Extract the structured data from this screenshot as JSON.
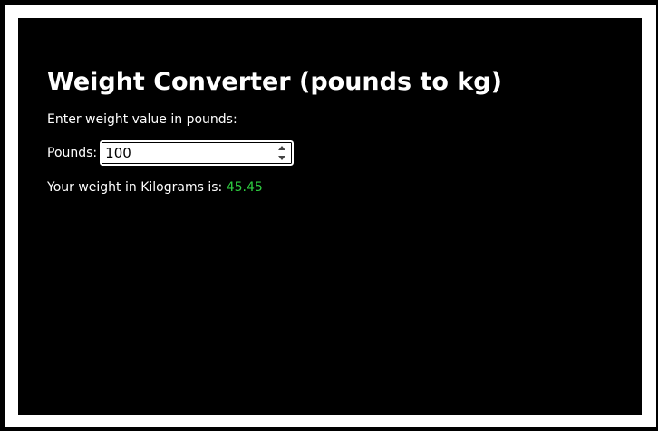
{
  "page": {
    "title": "Weight Converter (pounds to kg)",
    "instruction": "Enter weight value in pounds:"
  },
  "form": {
    "pounds_label": "Pounds:",
    "pounds_value": "100"
  },
  "result": {
    "label": "Your weight in Kilograms is:",
    "value": "45.45"
  },
  "colors": {
    "background": "#000000",
    "border": "#ffffff",
    "text": "#ffffff",
    "result_value": "#2ecc40"
  },
  "icons": {
    "spinner_up": "triangle-up-icon",
    "spinner_down": "triangle-down-icon"
  }
}
